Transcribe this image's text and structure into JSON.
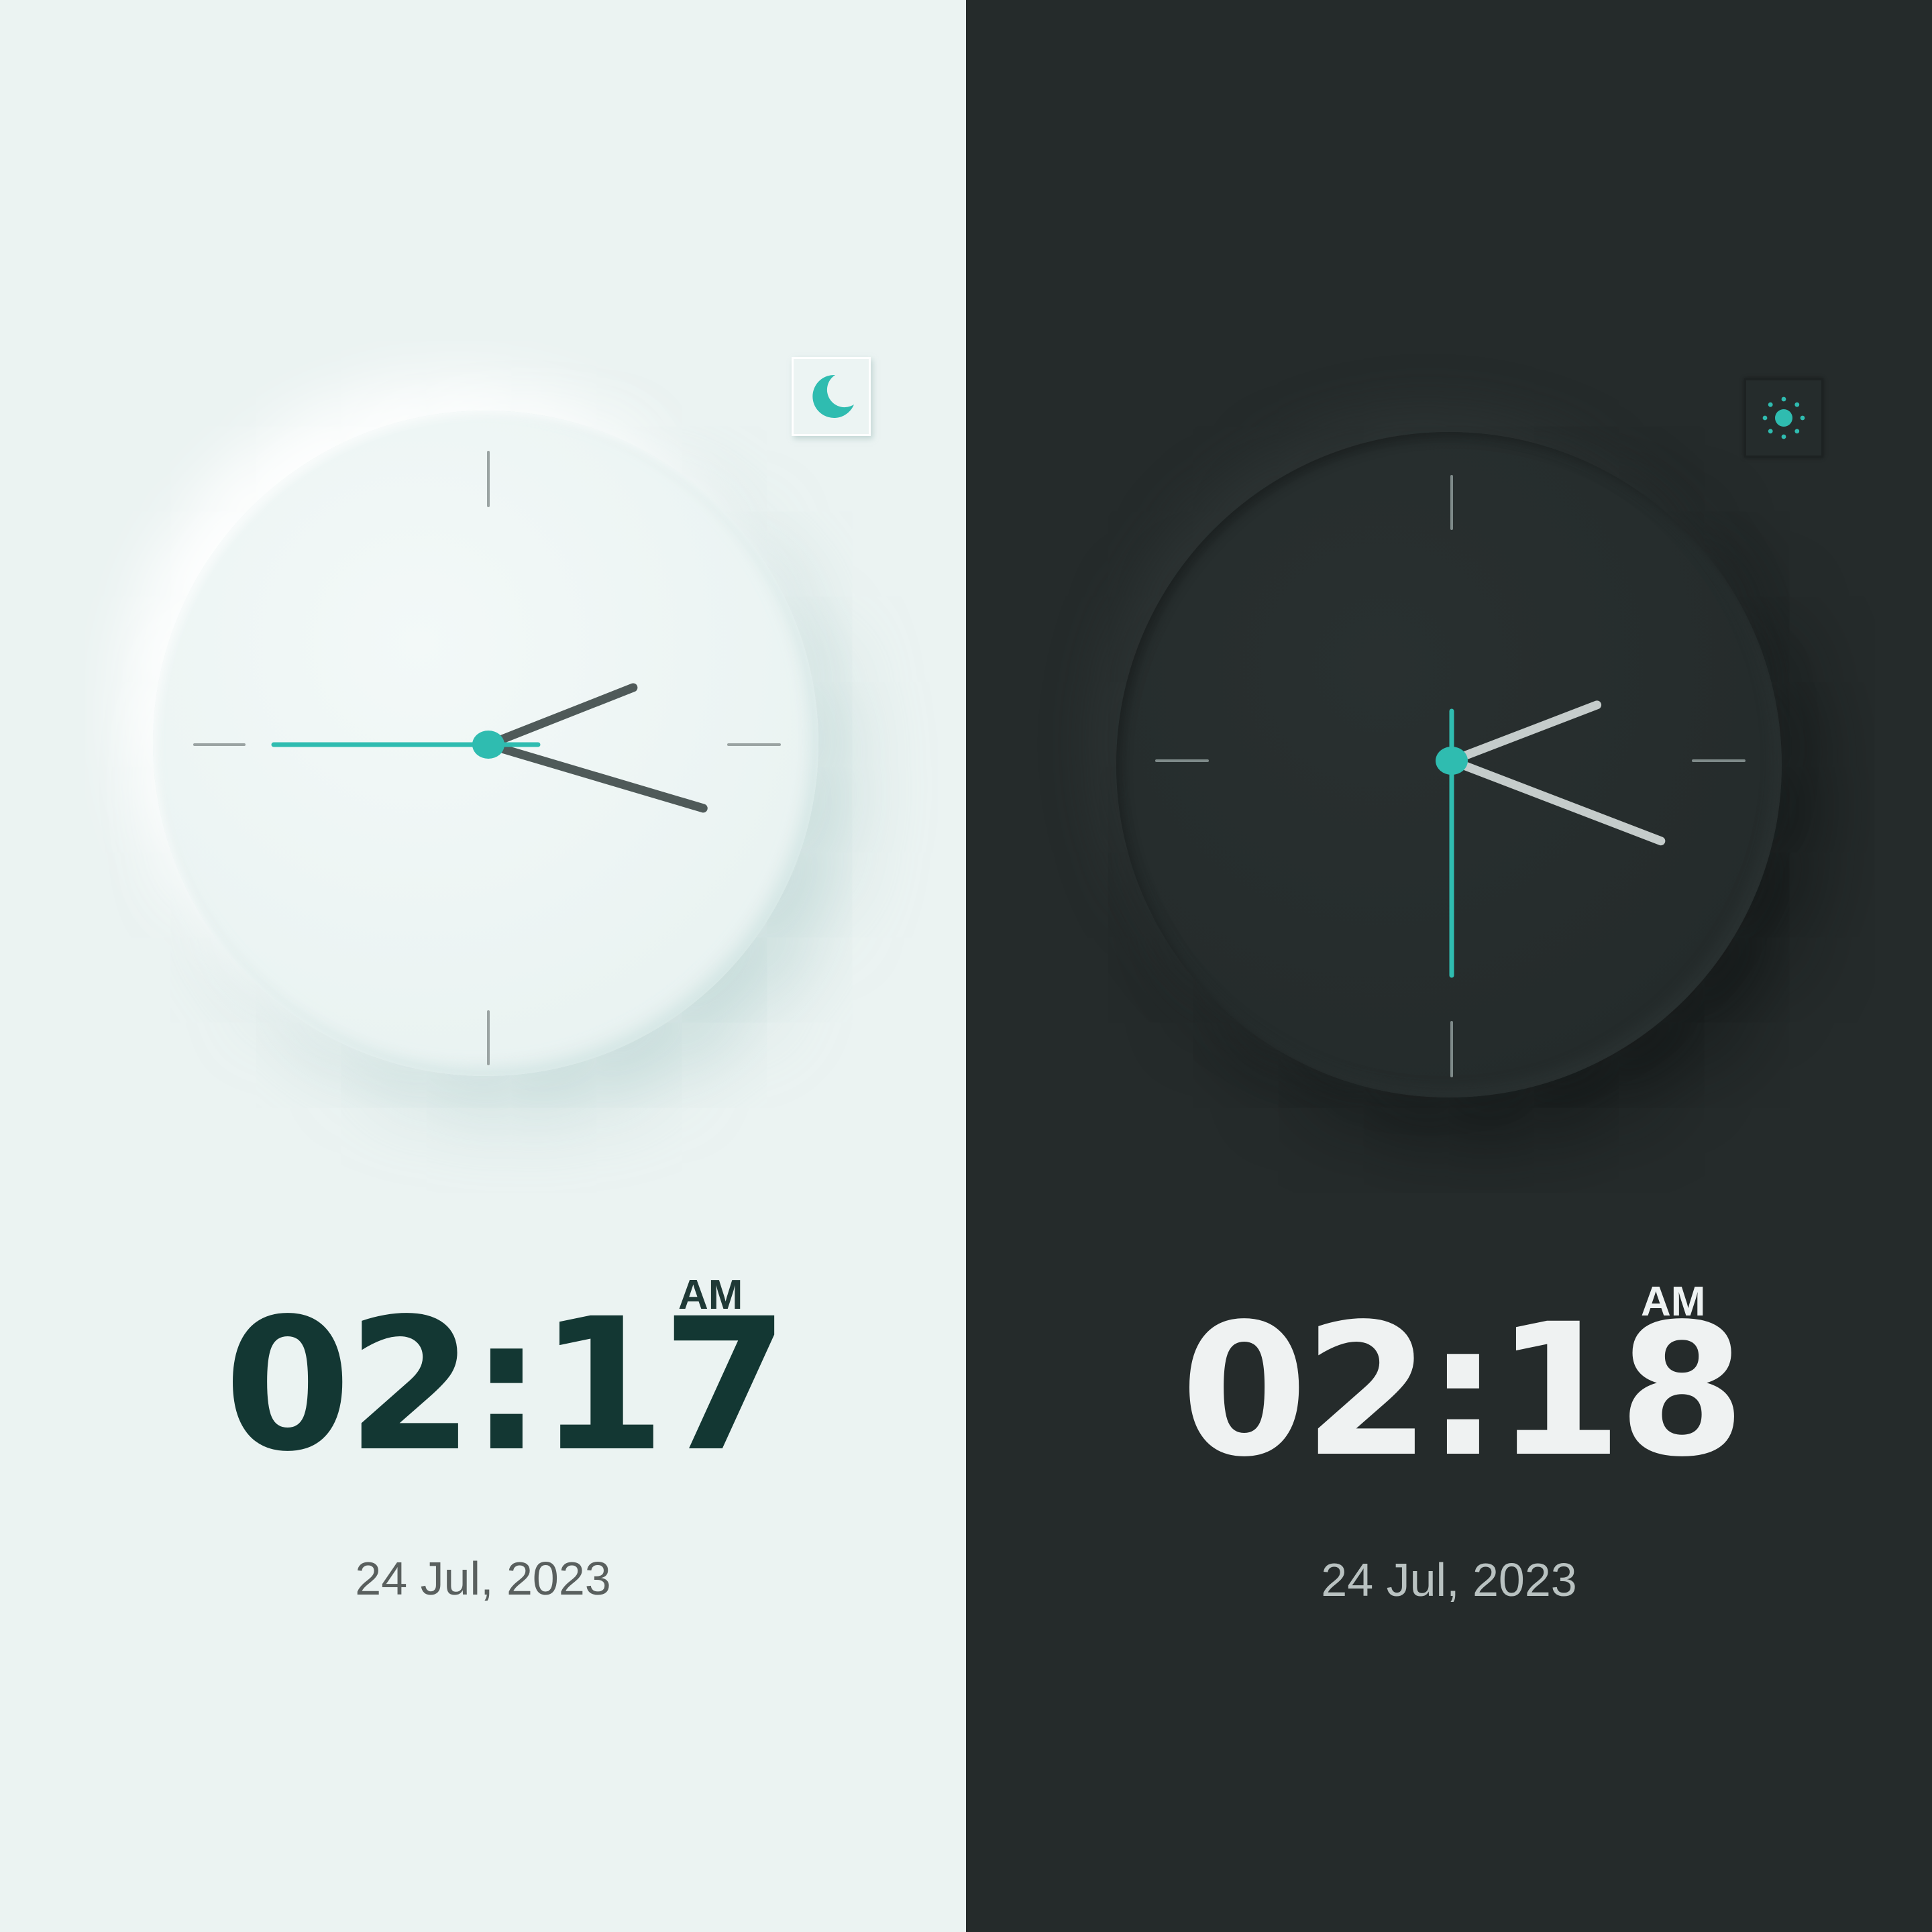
{
  "colors": {
    "accent": "#2fbcb0",
    "light_background": "#ebf3f2",
    "dark_background": "#252b2b",
    "light_hand": "#4f5a59",
    "dark_hand": "#c5cccb"
  },
  "light_panel": {
    "theme_toggle_icon": "moon-icon",
    "clock": {
      "hour": 2,
      "minute": 17,
      "second": 45
    },
    "time": "02:17",
    "period": "AM",
    "date": "24 Jul, 2023"
  },
  "dark_panel": {
    "theme_toggle_icon": "sun-icon",
    "clock": {
      "hour": 2,
      "minute": 18,
      "second": 30
    },
    "time": "02:18",
    "period": "AM",
    "date": "24 Jul, 2023"
  }
}
